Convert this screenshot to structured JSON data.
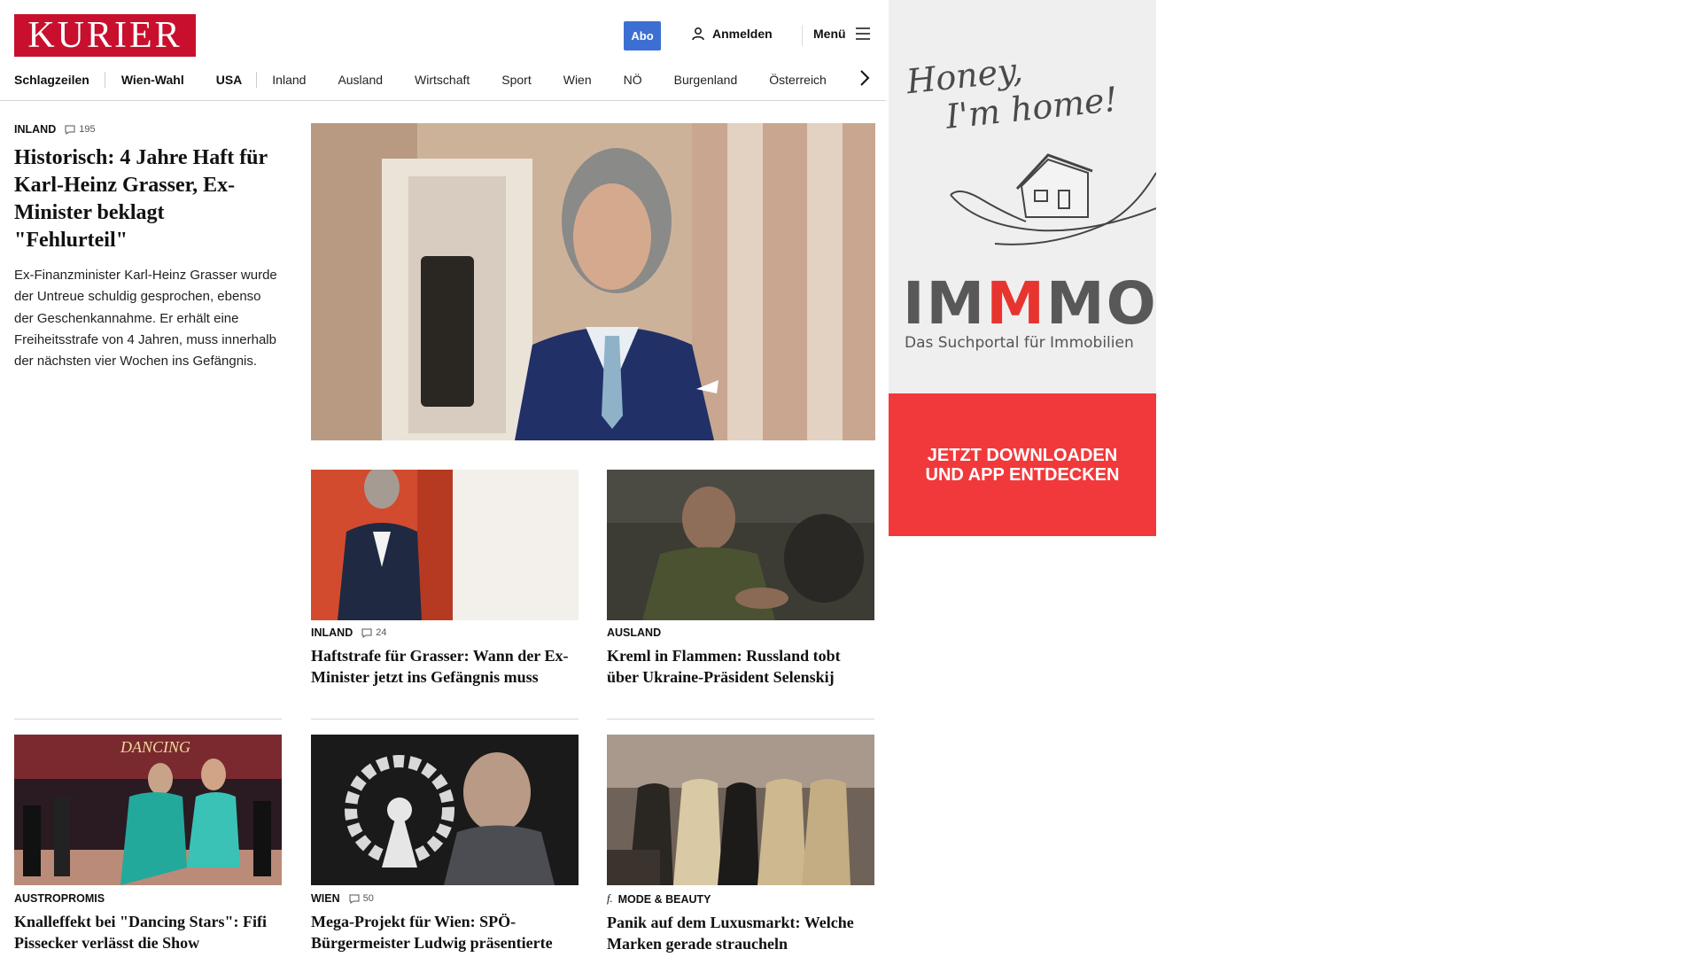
{
  "header": {
    "logo_text": "KURIER",
    "abo_label": "Abo",
    "login_label": "Anmelden",
    "menu_label": "Menü",
    "brand_color": "#c8102e",
    "accent_color": "#3c6fd1"
  },
  "nav": {
    "items": [
      "Schlagzeilen",
      "Wien-Wahl",
      "USA",
      "Inland",
      "Ausland",
      "Wirtschaft",
      "Sport",
      "Wien",
      "NÖ",
      "Burgenland",
      "Österreich"
    ]
  },
  "lead": {
    "category": "INLAND",
    "comments": "195",
    "headline": "Historisch: 4 Jahre Haft für Karl-Heinz Grasser, Ex-Minister beklagt \"Fehlurteil\"",
    "teaser": "Ex-Finanzminister Karl-Heinz Grasser wurde der Untreue schuldig gesprochen, ebenso der Geschenkannahme. Er erhält eine Freiheitsstrafe von 4 Jahren, muss innerhalb der nächsten vier Wochen ins Gefängnis."
  },
  "cards": [
    {
      "category": "INLAND",
      "comments": "24",
      "headline": "Haftstrafe für Grasser: Wann der Ex-Minister jetzt ins Gefängnis muss"
    },
    {
      "category": "AUSLAND",
      "comments": "",
      "headline": "Kreml in Flammen: Russland tobt über Ukraine-Präsident Selenskij"
    },
    {
      "category": "AUSTROPROMIS",
      "comments": "",
      "headline": "Knalleffekt bei \"Dancing Stars\": Fifi Pissecker verlässt die Show"
    },
    {
      "category": "WIEN",
      "comments": "50",
      "headline": "Mega-Projekt für Wien: SPÖ-Bürgermeister Ludwig präsentierte seine Pläne"
    },
    {
      "category": "MODE & BEAUTY",
      "comments": "",
      "headline": "Panik auf dem Luxusmarkt: Welche Marken gerade straucheln",
      "category_prefix": "f."
    }
  ],
  "ad": {
    "script_line1": "Honey,",
    "script_line2": "I'm home!",
    "logo_part1": "IM",
    "logo_part2": "M",
    "logo_part3": "MO",
    "tagline": "Das Suchportal für Immobilien",
    "cta_line1": "JETZT DOWNLOADEN",
    "cta_line2": "UND APP ENTDECKEN",
    "accent_color": "#f1393b"
  }
}
